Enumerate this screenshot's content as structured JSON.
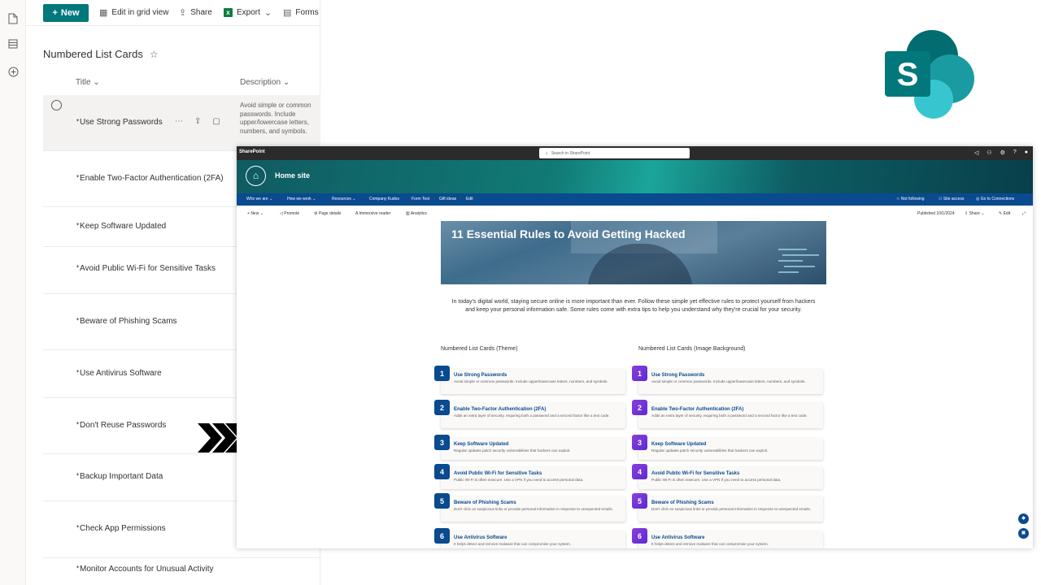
{
  "list_app": {
    "commandbar": {
      "new_label": "New",
      "edit_grid_label": "Edit in grid view",
      "share_label": "Share",
      "export_label": "Export",
      "forms_label": "Forms"
    },
    "title": "Numbered List Cards",
    "columns": {
      "title": "Title",
      "description": "Description"
    },
    "rows": [
      {
        "title": "Use Strong Passwords",
        "description": "Avoid simple or common passwords. Include upper/lowercase letters, numbers, and symbols."
      },
      {
        "title": "Enable Two-Factor Authentication (2FA)"
      },
      {
        "title": "Keep Software Updated"
      },
      {
        "title": "Avoid Public Wi-Fi for Sensitive Tasks"
      },
      {
        "title": "Beware of Phishing Scams"
      },
      {
        "title": "Use Antivirus Software"
      },
      {
        "title": "Don't Reuse Passwords"
      },
      {
        "title": "Backup Important Data"
      },
      {
        "title": "Check App Permissions"
      },
      {
        "title": "Monitor Accounts for Unusual Activity"
      }
    ]
  },
  "sharepoint": {
    "suite_name": "SharePoint",
    "search_placeholder": "Search in SharePoint",
    "site_title": "Home site",
    "nav": [
      "Who we are",
      "How we work",
      "Resources",
      "Company Kudos",
      "Form Test",
      "Gift ideas",
      "Edit"
    ],
    "nav_right": {
      "following": "Not following",
      "site_access": "Site access",
      "connections": "Go to Connections"
    },
    "page_cmds": {
      "new": "New",
      "promote": "Promote",
      "page_details": "Page details",
      "immersive": "Immersive reader",
      "analytics": "Analytics"
    },
    "page_meta": {
      "published": "Published 10/1/2024",
      "share": "Share",
      "edit": "Edit"
    },
    "hero_title": "11 Essential Rules to Avoid Getting Hacked",
    "intro": "In today's digital world, staying secure online is more important than ever. Follow these simple yet effective rules to protect yourself from hackers and keep your personal information safe. Some rules come with extra tips to help you understand why they're crucial for your security.",
    "section_theme": "Numbered List Cards (Theme)",
    "section_image": "Numbered List Cards (Image Background)",
    "cards": [
      {
        "n": "1",
        "title": "Use Strong Passwords",
        "desc": "Avoid simple or common passwords. Include upper/lowercase letters, numbers, and symbols."
      },
      {
        "n": "2",
        "title": "Enable Two-Factor Authentication (2FA)",
        "desc": "Adds an extra layer of security, requiring both a password and a second factor like a text code."
      },
      {
        "n": "3",
        "title": "Keep Software Updated",
        "desc": "Regular updates patch security vulnerabilities that hackers can exploit."
      },
      {
        "n": "4",
        "title": "Avoid Public Wi-Fi for Sensitive Tasks",
        "desc": "Public Wi-Fi is often insecure. Use a VPN if you need to access personal data."
      },
      {
        "n": "5",
        "title": "Beware of Phishing Scams",
        "desc": "Don't click on suspicious links or provide personal information in response to unexpected emails."
      },
      {
        "n": "6",
        "title": "Use Antivirus Software",
        "desc": "It helps detect and remove malware that can compromise your system."
      }
    ]
  },
  "colors": {
    "teal": "#03787c",
    "navy": "#0a4a8f",
    "purple": "#7b35d8"
  },
  "icons": [
    "file-icon",
    "list-icon",
    "add-circle-icon",
    "grid-icon",
    "share-icon",
    "excel-icon",
    "forms-icon",
    "star-icon",
    "sharepoint-logo",
    "arrow-icon"
  ]
}
